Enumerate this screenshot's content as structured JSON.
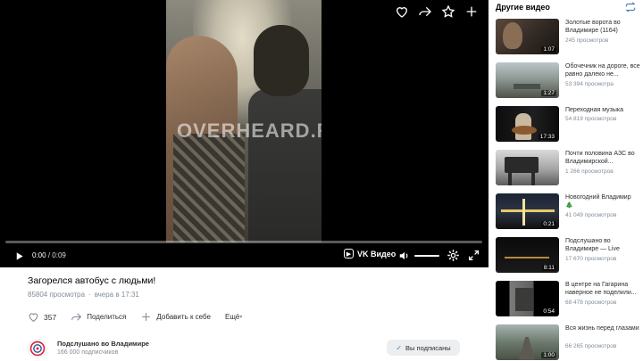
{
  "player": {
    "watermark": "OVERHEARD.RU",
    "current_time": "0:00",
    "duration": "0:09",
    "progress": 0.0,
    "brand": "VK Видео",
    "volume": 1.0
  },
  "video": {
    "title": "Загорелся автобус с людьми!",
    "views": "85804 просмотра",
    "date": "вчера в 17:31",
    "likes": "357",
    "share_label": "Поделиться",
    "add_label": "Добавить к себе",
    "more_label": "Ещё"
  },
  "channel": {
    "name": "Подслушано во Владимире",
    "subscribers": "166 000 подписчиков",
    "subscribed_label": "Вы подписаны"
  },
  "sidebar": {
    "heading": "Другие видео",
    "items": [
      {
        "title": "Золотые ворота во Владимире (1164)",
        "views": "245 просмотров",
        "duration": "1:07"
      },
      {
        "title": "Обочечник на дороге, все равно далеко не...",
        "views": "53 394 просмотра",
        "duration": "1:27"
      },
      {
        "title": "Переходная музыка",
        "views": "54 819 просмотров",
        "duration": "17:33"
      },
      {
        "title": "Почти половина АЗС во Владимирской...",
        "views": "1 266 просмотров",
        "duration": ""
      },
      {
        "title": "Новогодний Владимир 🎄",
        "views": "41 049 просмотров",
        "duration": "0:21"
      },
      {
        "title": "Подслушано во Владимире — Live",
        "views": "17 670 просмотров",
        "duration": "8:11"
      },
      {
        "title": "В центре на Гагарина наверное не поделили...",
        "views": "68 478 просмотров",
        "duration": "0:54"
      },
      {
        "title": "Вся жизнь перед глазами",
        "views": "66 265 просмотров",
        "duration": "1:00"
      }
    ]
  },
  "colors": {
    "accent": "#5181b8",
    "muted": "#818c99",
    "text": "#2c2d2e"
  }
}
